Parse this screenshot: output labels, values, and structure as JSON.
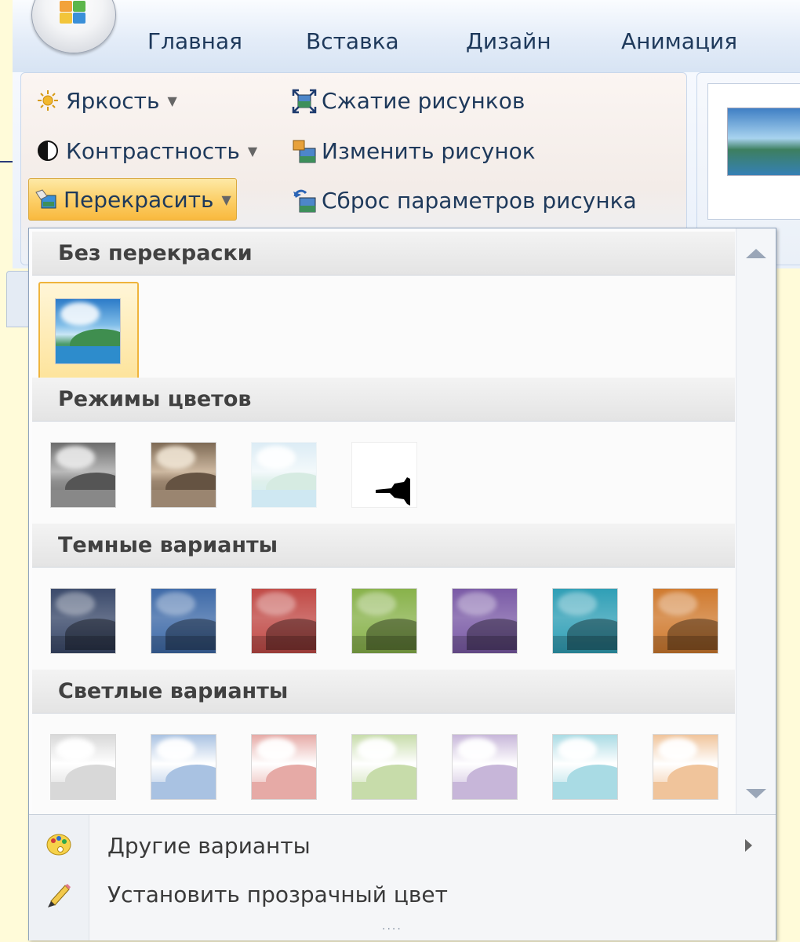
{
  "ribbon_tabs": [
    "Главная",
    "Вставка",
    "Дизайн",
    "Анимация"
  ],
  "adjust_group": {
    "brightness": "Яркость",
    "contrast": "Контрастность",
    "recolor": "Перекрасить",
    "compress": "Сжатие рисунков",
    "change_picture": "Изменить рисунок",
    "reset_picture": "Сброс параметров рисунка"
  },
  "recolor_menu": {
    "sections": {
      "no_recolor": "Без перекраски",
      "color_modes": "Режимы цветов",
      "dark_variations": "Темные варианты",
      "light_variations": "Светлые варианты"
    },
    "color_modes": [
      "grayscale",
      "sepia",
      "washout",
      "black-and-white"
    ],
    "dark_variations": [
      "#3b4a6b",
      "#3e6aa8",
      "#c14a46",
      "#88b24a",
      "#7a5aa6",
      "#2f9fb6",
      "#d07a2e"
    ],
    "light_variations": [
      "#d8d8d8",
      "#a9c2e2",
      "#e6aaa6",
      "#c7dcaa",
      "#c7b6d9",
      "#a9dbe4",
      "#f0c49b"
    ],
    "more_variations": "Другие варианты",
    "set_transparent": "Установить прозрачный цвет"
  }
}
